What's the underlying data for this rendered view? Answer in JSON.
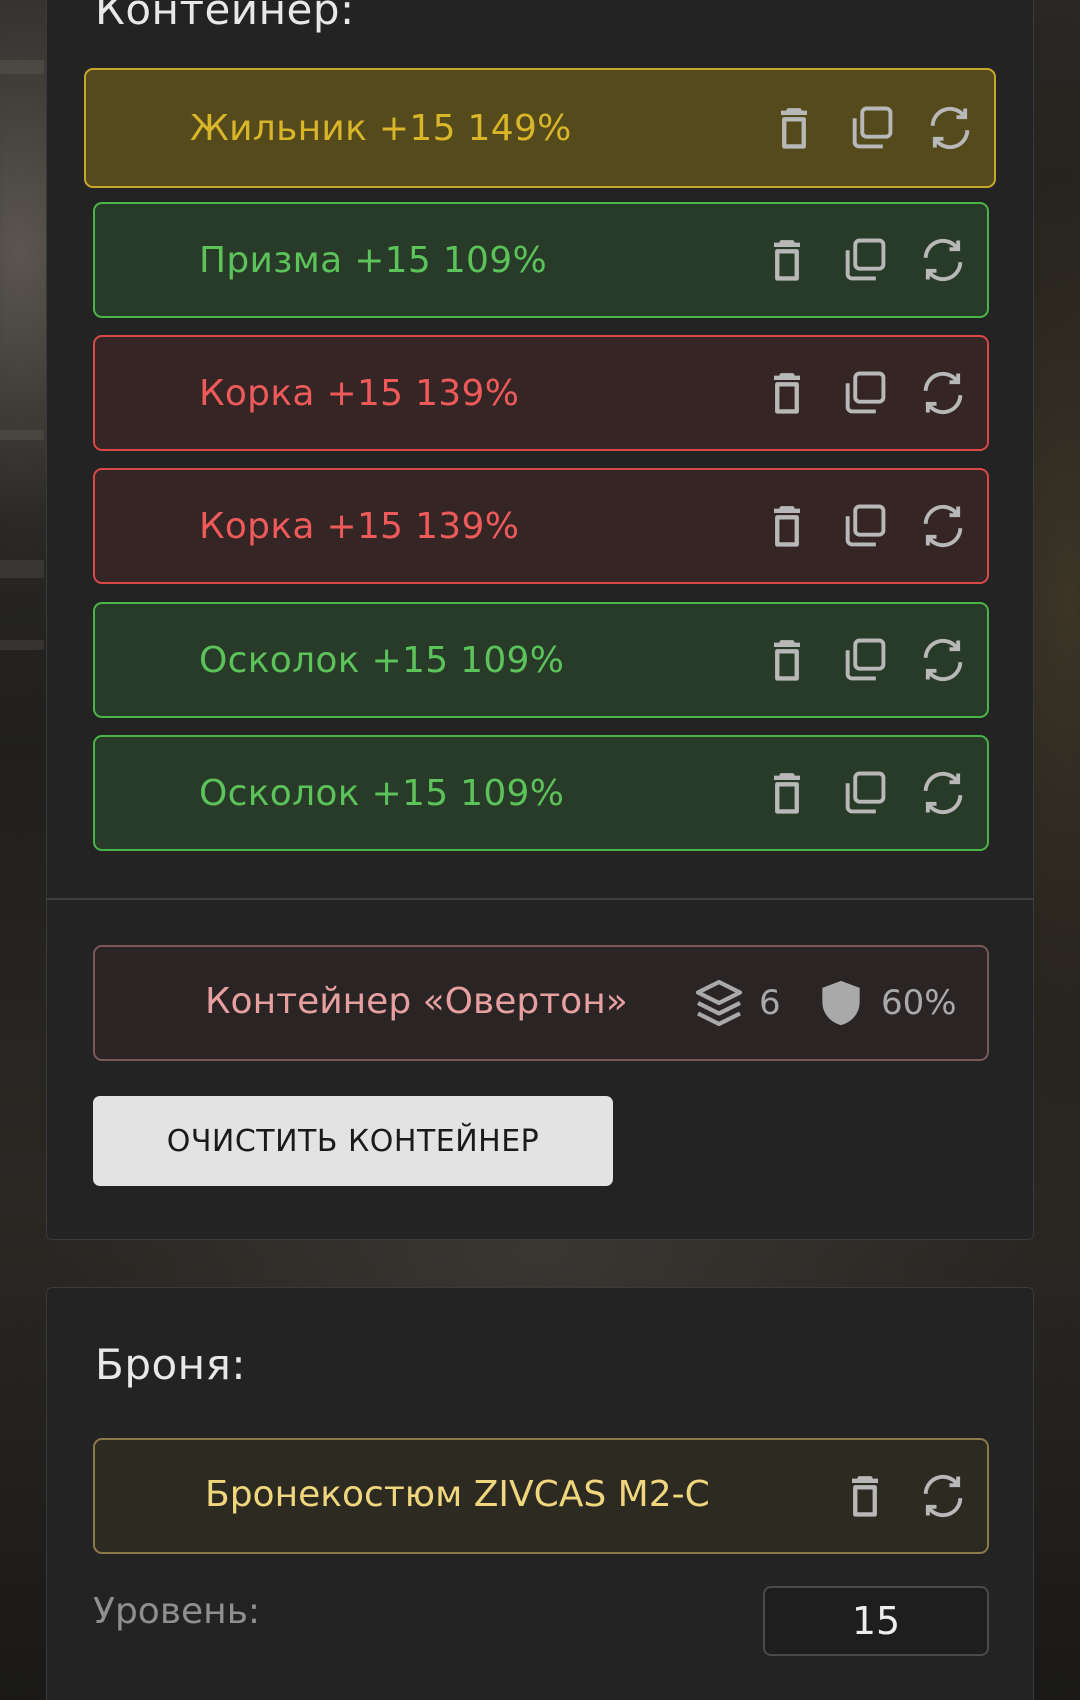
{
  "container_section": {
    "heading": "Контейнер:",
    "items": [
      {
        "label": "Жильник +15 149%",
        "color": "yellow"
      },
      {
        "label": "Призма +15 109%",
        "color": "green"
      },
      {
        "label": "Корка +15 139%",
        "color": "red"
      },
      {
        "label": "Корка +15 139%",
        "color": "red"
      },
      {
        "label": "Осколок +15 109%",
        "color": "green"
      },
      {
        "label": "Осколок +15 109%",
        "color": "green"
      }
    ],
    "item_icons": [
      "trash-icon",
      "copy-icon",
      "refresh-icon"
    ],
    "container": {
      "label": "Контейнер «Овертон»",
      "slots_icon": "layers-icon",
      "slots": "6",
      "protection_icon": "shield-icon",
      "protection": "60%"
    },
    "clear_button": "ОЧИСТИТЬ КОНТЕЙНЕР"
  },
  "armor_section": {
    "heading": "Броня:",
    "armor": {
      "label": "Бронекостюм ZIVCAS M2-C"
    },
    "level_label": "Уровень:",
    "level_value": "15"
  },
  "colors": {
    "yellow_text": "#d9b52a",
    "green_text": "#5cc25a",
    "red_text": "#ee5a5a",
    "armor_text": "#f0d77e",
    "container_text": "#e7a0a0"
  }
}
